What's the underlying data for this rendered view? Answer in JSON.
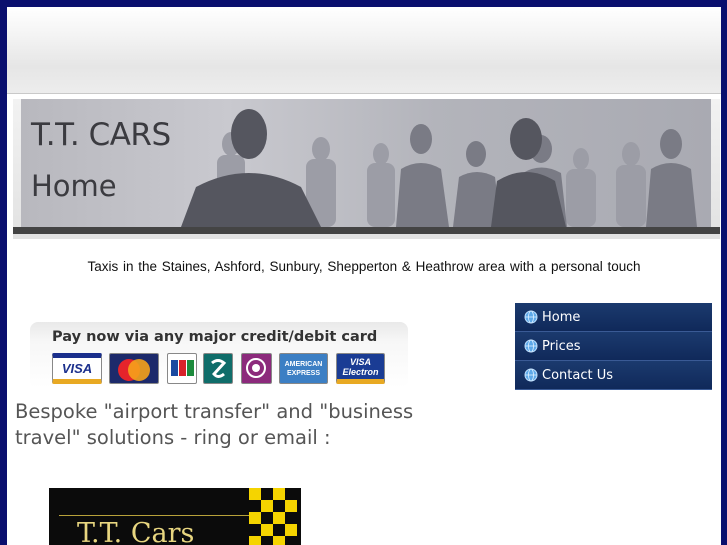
{
  "header": {
    "site_title": "T.T. CARS",
    "page_name": "Home"
  },
  "tagline": "Taxis  in the Staines,  Ashford,  Sunbury,  Shepperton & Heathrow  area with  a personal touch",
  "payment": {
    "title": "Pay now via any major credit/debit card",
    "cards": [
      {
        "label": "VISA",
        "icon": "visa-card-icon"
      },
      {
        "label": "MasterCard",
        "icon": "mastercard-card-icon"
      },
      {
        "label": "JCB",
        "icon": "jcb-card-icon"
      },
      {
        "label": "SWITCH",
        "icon": "switch-card-icon"
      },
      {
        "label": "SOLO",
        "icon": "solo-card-icon"
      },
      {
        "label": "AMERICAN EXPRESS",
        "icon": "amex-card-icon"
      },
      {
        "label": "VISA Electron",
        "icon": "visa-electron-card-icon"
      }
    ]
  },
  "bespoke_text": "Bespoke \"airport transfer\" and \"business travel\" solutions - ring or email :",
  "promo": {
    "text": "T.T. Cars"
  },
  "nav": {
    "items": [
      {
        "label": "Home"
      },
      {
        "label": "Prices"
      },
      {
        "label": "Contact  Us"
      }
    ]
  },
  "colors": {
    "frame": "#0a0f6e",
    "nav_bg": "#14305f",
    "promo_bg": "#0b0b0b",
    "promo_gold": "#e8d680"
  }
}
